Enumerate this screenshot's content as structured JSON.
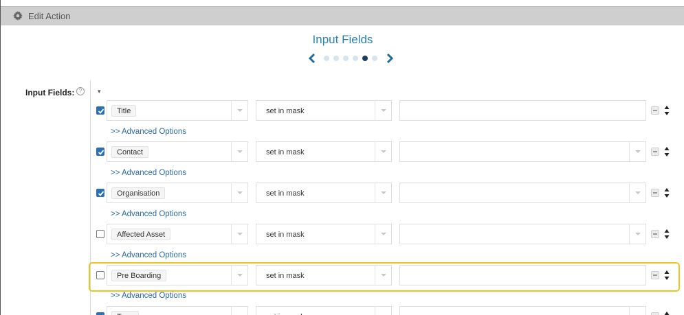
{
  "window": {
    "title": "Edit Action"
  },
  "wizard": {
    "title": "Input Fields",
    "steps": 6,
    "active_step": 5
  },
  "form": {
    "label": "Input Fields:",
    "help_glyph": "?",
    "rows": [
      {
        "checked": true,
        "field": "Title",
        "mode": "set in mask",
        "value": "",
        "advanced": ">> Advanced Options"
      },
      {
        "checked": true,
        "field": "Contact",
        "mode": "set in mask",
        "value": "",
        "advanced": ">> Advanced Options"
      },
      {
        "checked": true,
        "field": "Organisation",
        "mode": "set in mask",
        "value": "",
        "advanced": ">> Advanced Options"
      },
      {
        "checked": false,
        "field": "Affected Asset",
        "mode": "set in mask",
        "value": "",
        "advanced": ">> Advanced Options"
      },
      {
        "checked": false,
        "field": "Pre Boarding",
        "mode": "set in mask",
        "value": "",
        "advanced": ">> Advanced Options"
      },
      {
        "checked": true,
        "field": "Type",
        "mode": "set in mask",
        "value": "",
        "advanced": ""
      }
    ]
  },
  "colors": {
    "accent": "#2a82ad",
    "highlight": "#f0c41e",
    "checkbox": "#2b6fb5"
  }
}
